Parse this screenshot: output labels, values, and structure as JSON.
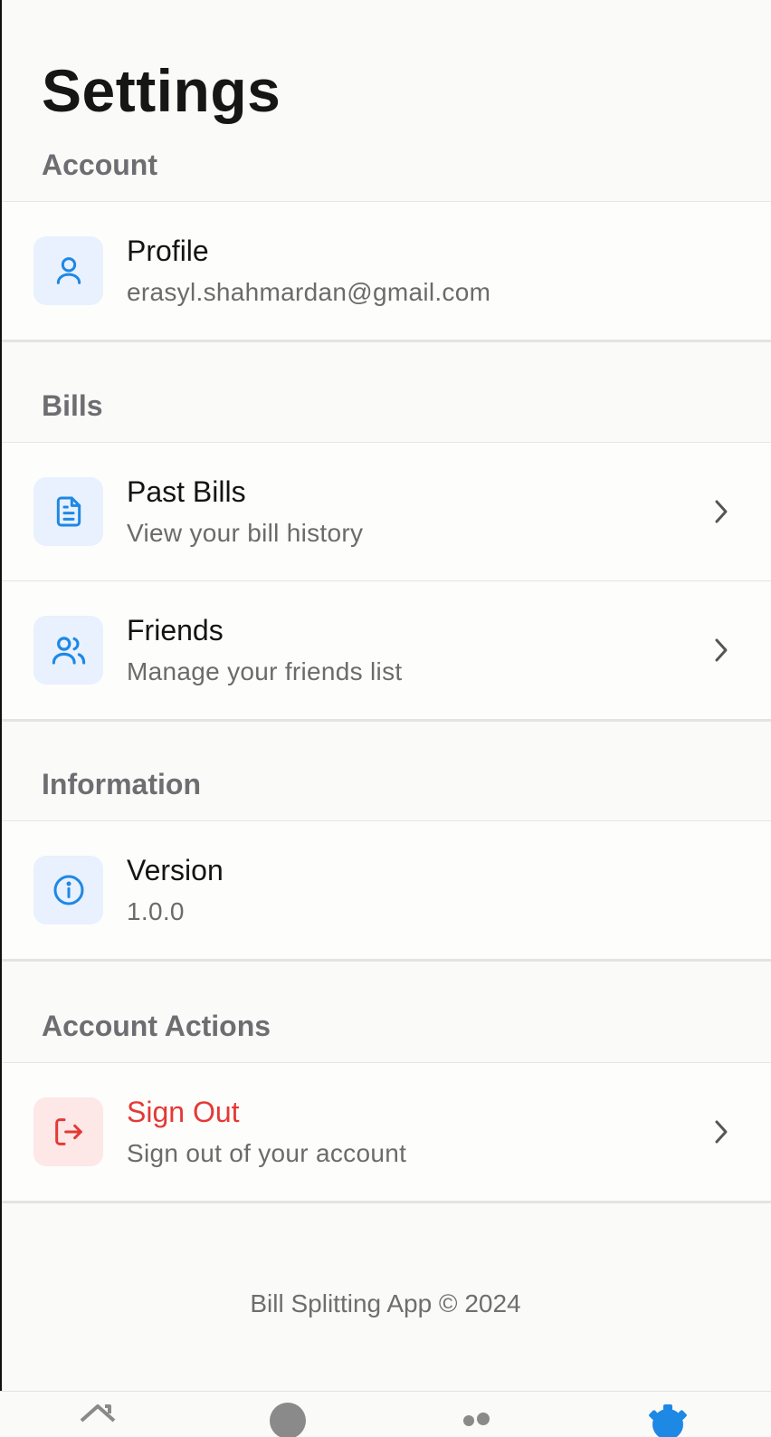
{
  "page": {
    "title": "Settings"
  },
  "sections": {
    "account": {
      "label": "Account",
      "profile": {
        "title": "Profile",
        "subtitle": "erasyl.shahmardan@gmail.com",
        "icon": "user-icon"
      }
    },
    "bills": {
      "label": "Bills",
      "past_bills": {
        "title": "Past Bills",
        "subtitle": "View your bill history",
        "icon": "document-icon"
      },
      "friends": {
        "title": "Friends",
        "subtitle": "Manage your friends list",
        "icon": "users-icon"
      }
    },
    "information": {
      "label": "Information",
      "version": {
        "title": "Version",
        "subtitle": "1.0.0",
        "icon": "info-icon"
      }
    },
    "account_actions": {
      "label": "Account Actions",
      "sign_out": {
        "title": "Sign Out",
        "subtitle": "Sign out of your account",
        "icon": "logout-icon"
      }
    }
  },
  "footer": {
    "text": "Bill Splitting App © 2024"
  },
  "tab_bar": {
    "tabs": [
      {
        "icon": "home-icon"
      },
      {
        "icon": "circle-icon"
      },
      {
        "icon": "users-icon"
      },
      {
        "icon": "gear-icon",
        "active": true
      }
    ]
  },
  "colors": {
    "accent": "#1e88e5",
    "danger": "#e53935",
    "icon_bg": "#e8f1fd",
    "danger_bg": "#fde7e7"
  }
}
